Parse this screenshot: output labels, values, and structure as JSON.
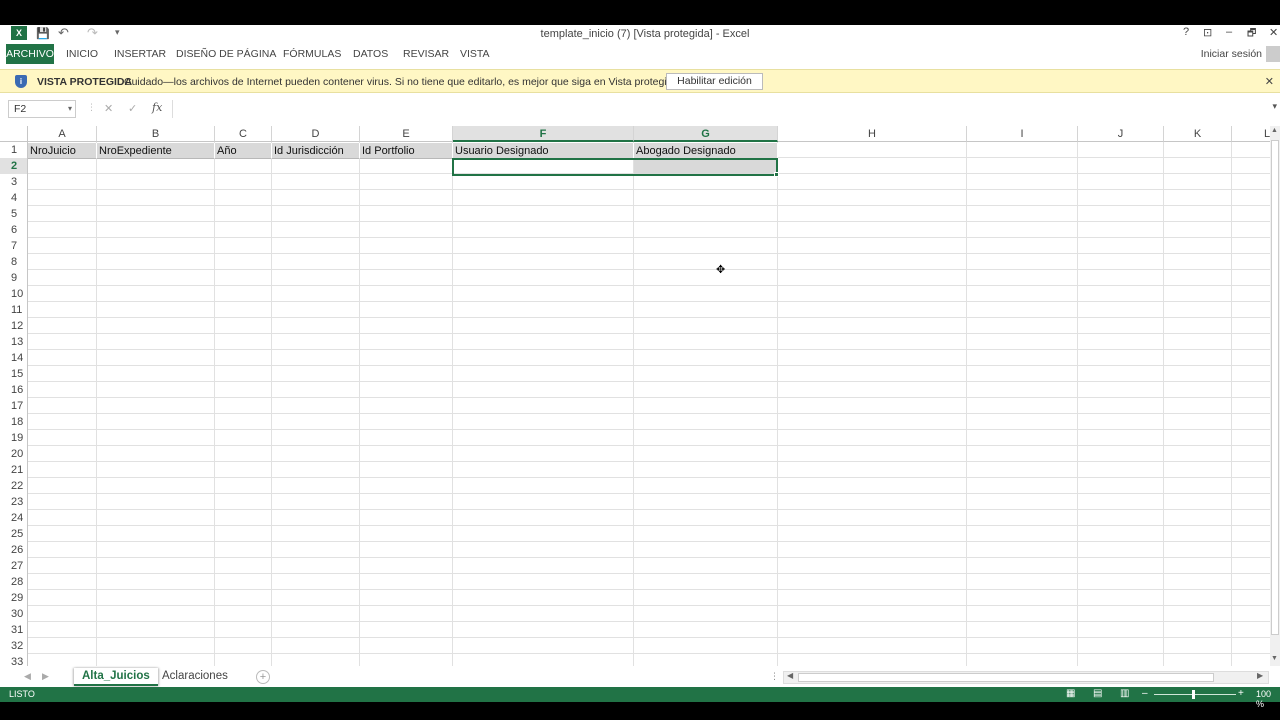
{
  "window": {
    "title": "template_inicio (7)  [Vista protegida] - Excel",
    "help": "?",
    "restore_ribbon": "⊡",
    "minimize": "–",
    "maximize": "🗗",
    "close": "✕"
  },
  "quick_access": {
    "save": "💾",
    "undo": "↶",
    "redo": "↷",
    "customize": "▾"
  },
  "ribbon": {
    "tabs": [
      "ARCHIVO",
      "INICIO",
      "INSERTAR",
      "DISEÑO DE PÁGINA",
      "FÓRMULAS",
      "DATOS",
      "REVISAR",
      "VISTA"
    ],
    "sign_in": "Iniciar sesión"
  },
  "protected_view": {
    "label": "VISTA PROTEGIDA",
    "message": "Cuidado—los archivos de Internet pueden contener virus. Si no tiene que editarlo, es mejor que siga en Vista protegida.",
    "enable_button": "Habilitar edición",
    "close": "✕"
  },
  "formula_bar": {
    "name_box": "F2",
    "cancel": "✕",
    "enter": "✓",
    "fx": "fx",
    "value": ""
  },
  "sheet": {
    "columns": [
      "A",
      "B",
      "C",
      "D",
      "E",
      "F",
      "G",
      "H",
      "I",
      "J",
      "K",
      "L"
    ],
    "selected_column": "F",
    "rows": [
      "1",
      "2",
      "3",
      "4",
      "5",
      "6",
      "7",
      "8",
      "9",
      "10",
      "11",
      "12",
      "13",
      "14",
      "15",
      "16",
      "17",
      "18",
      "19",
      "20",
      "21",
      "22",
      "23",
      "24",
      "25",
      "26",
      "27",
      "28",
      "29",
      "30",
      "31",
      "32",
      "33"
    ],
    "selected_row": "2",
    "header_row": [
      "NroJuicio",
      "NroExpediente",
      "Año",
      "Id Jurisdicción",
      "Id Portfolio",
      "Usuario Designado",
      "Abogado Designado"
    ],
    "active_cell": "F2"
  },
  "sheet_tabs": {
    "tabs": [
      "Alta_Juicios",
      "Aclaraciones"
    ],
    "active": "Alta_Juicios",
    "add": "+"
  },
  "status_bar": {
    "state": "LISTO",
    "zoom": "100 %"
  },
  "colors": {
    "excel_green": "#217346",
    "protected_bar": "#fff7c4",
    "header_fill": "#d9d9d9"
  }
}
